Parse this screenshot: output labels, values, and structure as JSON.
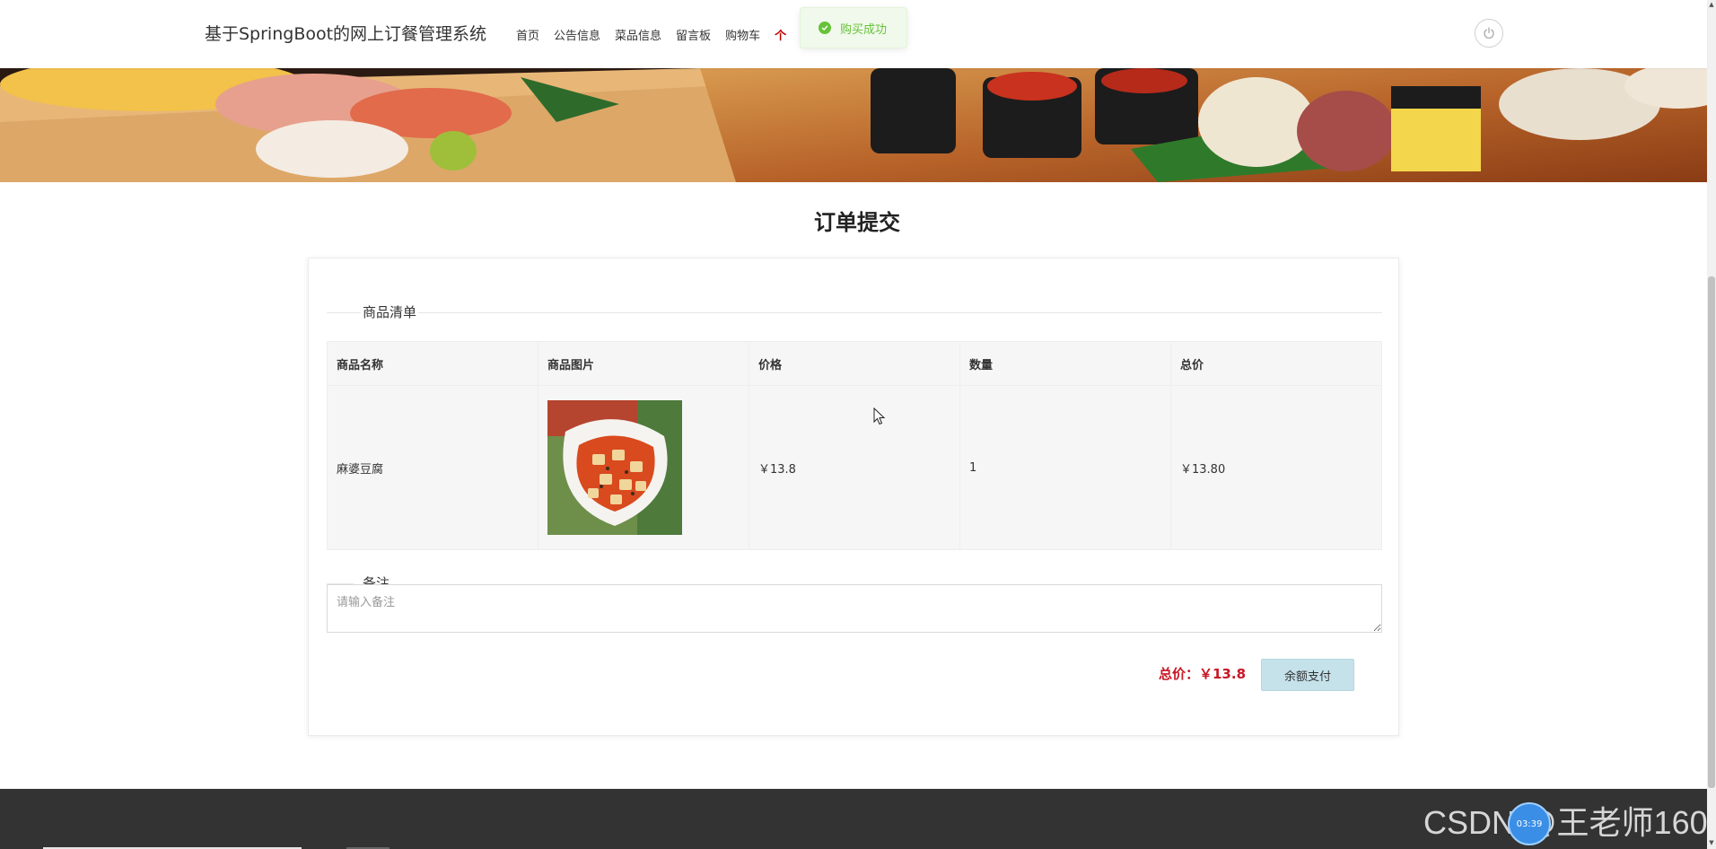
{
  "header": {
    "site_title": "基于SpringBoot的网上订餐管理系统",
    "nav": [
      "首页",
      "公告信息",
      "菜品信息",
      "留言板",
      "购物车"
    ],
    "nav_more": "个"
  },
  "toast": {
    "message": "购买成功",
    "icon": "check-circle-icon"
  },
  "page": {
    "title": "订单提交"
  },
  "order": {
    "section_title": "商品清单",
    "columns": [
      "商品名称",
      "商品图片",
      "价格",
      "数量",
      "总价"
    ],
    "rows": [
      {
        "name": "麻婆豆腐",
        "image": "mapo-tofu-dish-image",
        "price": "￥13.8",
        "quantity": "1",
        "total": "￥13.80"
      }
    ],
    "remark_title": "备注",
    "remark_placeholder": "请输入备注",
    "total_label": "总价：￥13.8",
    "pay_button": "余额支付"
  },
  "watermark": {
    "text": "CSDN @王老师160",
    "bubble": "03:39"
  },
  "colors": {
    "accent_red": "#c81623",
    "toast_green": "#67c23a",
    "footer_bg": "#333333",
    "pay_button_bg": "#c5e1ea"
  }
}
